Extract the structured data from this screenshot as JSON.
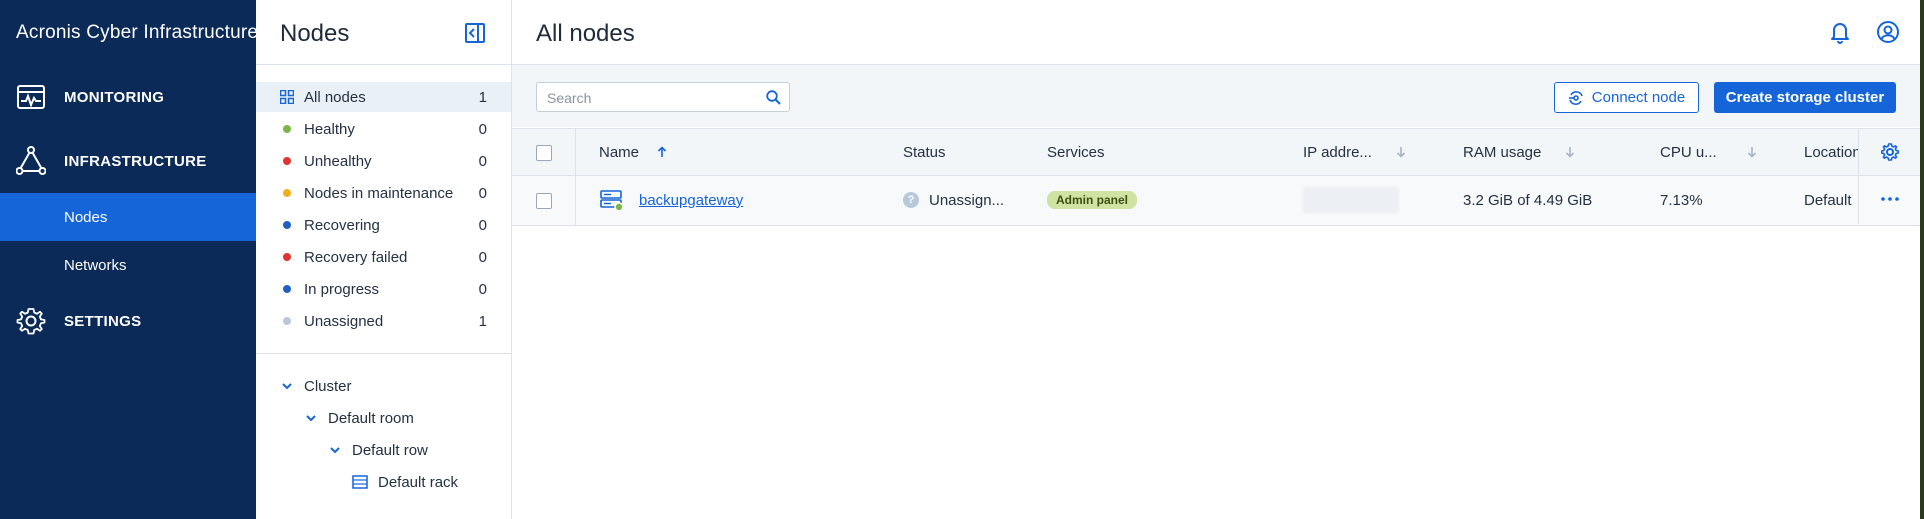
{
  "app": {
    "brand_strong": "Acronis",
    "brand_light": "Cyber Infrastructure",
    "accent_color": "#1565d8",
    "nav_bg": "#0b2a57"
  },
  "nav": {
    "monitoring": "MONITORING",
    "infrastructure": "INFRASTRUCTURE",
    "nodes": "Nodes",
    "networks": "Networks",
    "settings": "SETTINGS",
    "active": "Nodes"
  },
  "panel": {
    "title": "Nodes",
    "filters": [
      {
        "label": "All nodes",
        "count": "1",
        "color": null,
        "active": true
      },
      {
        "label": "Healthy",
        "count": "0",
        "color": "#7ab648"
      },
      {
        "label": "Unhealthy",
        "count": "0",
        "color": "#e0342f"
      },
      {
        "label": "Nodes in maintenance",
        "count": "0",
        "color": "#f2b01e"
      },
      {
        "label": "Recovering",
        "count": "0",
        "color": "#1f5fbf"
      },
      {
        "label": "Recovery failed",
        "count": "0",
        "color": "#e0342f"
      },
      {
        "label": "In progress",
        "count": "0",
        "color": "#1f5fbf"
      },
      {
        "label": "Unassigned",
        "count": "1",
        "color": "#b8c8dc"
      }
    ],
    "tree": {
      "cluster": "Cluster",
      "room": "Default room",
      "row": "Default row",
      "rack": "Default rack"
    }
  },
  "main": {
    "title": "All nodes",
    "search": {
      "placeholder": "Search",
      "value": ""
    },
    "connect_node_label": "Connect node",
    "create_cluster_label": "Create storage cluster",
    "columns": {
      "name": "Name",
      "status": "Status",
      "services": "Services",
      "ip": "IP addre...",
      "ram": "RAM usage",
      "cpu": "CPU u...",
      "location": "Location"
    },
    "rows": [
      {
        "name": "backupgateway",
        "status": "Unassign...",
        "service_badge": "Admin panel",
        "ip": "",
        "ram": "3.2 GiB of 4.49 GiB",
        "cpu": "7.13%",
        "location": "Default"
      }
    ]
  }
}
